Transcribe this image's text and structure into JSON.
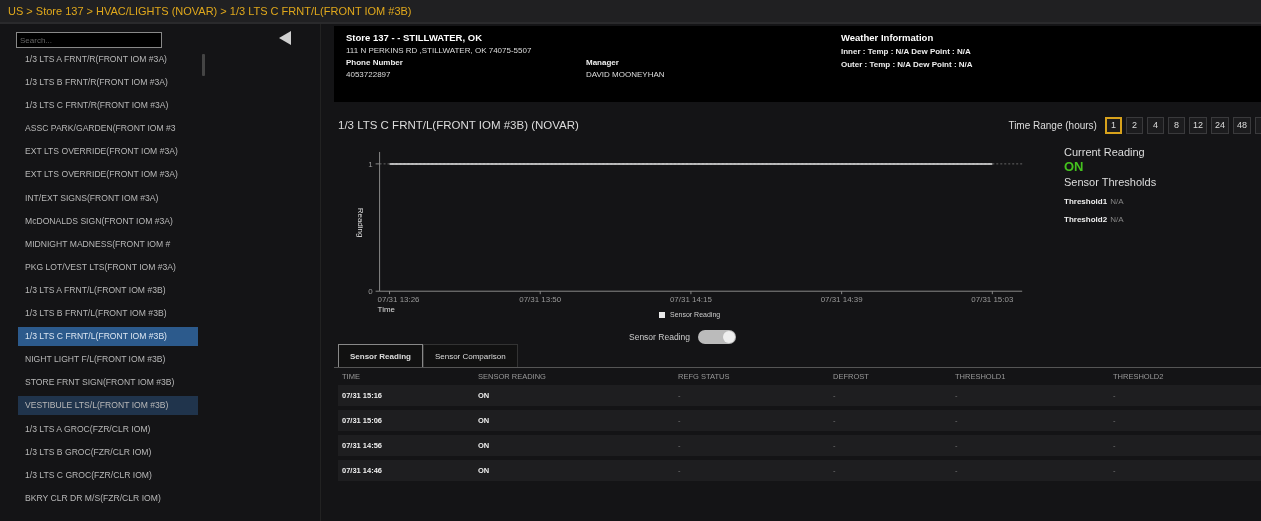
{
  "breadcrumb": "US > Store 137 > HVAC/LIGHTS (NOVAR) > 1/3 LTS C FRNT/L(FRONT IOM #3B)",
  "sidebar": {
    "search": {
      "placeholder": "Search..."
    },
    "items": [
      {
        "label": "1/3 LTS A FRNT/R(FRONT IOM #3A)",
        "selected": false,
        "highlighted": false
      },
      {
        "label": "1/3 LTS B FRNT/R(FRONT IOM #3A)",
        "selected": false,
        "highlighted": false
      },
      {
        "label": "1/3 LTS C FRNT/R(FRONT IOM #3A)",
        "selected": false,
        "highlighted": false
      },
      {
        "label": "ASSC PARK/GARDEN(FRONT IOM #3",
        "selected": false,
        "highlighted": false
      },
      {
        "label": "EXT LTS OVERRIDE(FRONT IOM #3A)",
        "selected": false,
        "highlighted": false
      },
      {
        "label": "EXT LTS OVERRIDE(FRONT IOM #3A)",
        "selected": false,
        "highlighted": false
      },
      {
        "label": "INT/EXT SIGNS(FRONT IOM #3A)",
        "selected": false,
        "highlighted": false
      },
      {
        "label": "McDONALDS SIGN(FRONT IOM #3A)",
        "selected": false,
        "highlighted": false
      },
      {
        "label": "MIDNIGHT MADNESS(FRONT IOM #",
        "selected": false,
        "highlighted": false
      },
      {
        "label": "PKG LOT/VEST LTS(FRONT IOM #3A)",
        "selected": false,
        "highlighted": false
      },
      {
        "label": "1/3 LTS A FRNT/L(FRONT IOM #3B)",
        "selected": false,
        "highlighted": false
      },
      {
        "label": "1/3 LTS B FRNT/L(FRONT IOM #3B)",
        "selected": false,
        "highlighted": false
      },
      {
        "label": "1/3 LTS C FRNT/L(FRONT IOM #3B)",
        "selected": true,
        "highlighted": false
      },
      {
        "label": "NIGHT LIGHT F/L(FRONT IOM #3B)",
        "selected": false,
        "highlighted": false
      },
      {
        "label": "STORE FRNT SIGN(FRONT IOM #3B)",
        "selected": false,
        "highlighted": false
      },
      {
        "label": "VESTIBULE LTS/L(FRONT IOM #3B)",
        "selected": false,
        "highlighted": true
      },
      {
        "label": "1/3 LTS A GROC(FZR/CLR IOM)",
        "selected": false,
        "highlighted": false
      },
      {
        "label": "1/3 LTS B GROC(FZR/CLR IOM)",
        "selected": false,
        "highlighted": false
      },
      {
        "label": "1/3 LTS C GROC(FZR/CLR IOM)",
        "selected": false,
        "highlighted": false
      },
      {
        "label": "BKRY CLR DR M/S(FZR/CLR IOM)",
        "selected": false,
        "highlighted": false
      }
    ]
  },
  "store": {
    "title": "Store 137 - - STILLWATER, OK",
    "address": "111 N PERKINS RD ,STILLWATER, OK 74075-5507",
    "phone_label": "Phone Number",
    "phone": "4053722897",
    "manager_label": "Manager",
    "manager": "DAVID MOONEYHAN"
  },
  "weather": {
    "title": "Weather Information",
    "inner": "Inner : Temp : N/A Dew Point : N/A",
    "outer": "Outer : Temp : N/A Dew Point : N/A"
  },
  "sensor_title": "1/3 LTS C FRNT/L(FRONT IOM #3B) (NOVAR)",
  "time_range": {
    "label": "Time Range (hours)",
    "options": [
      {
        "label": "1",
        "selected": true
      },
      {
        "label": "2",
        "selected": false
      },
      {
        "label": "4",
        "selected": false
      },
      {
        "label": "8",
        "selected": false
      },
      {
        "label": "12",
        "selected": false
      },
      {
        "label": "24",
        "selected": false
      },
      {
        "label": "48",
        "selected": false
      }
    ]
  },
  "chart": {
    "chart_data": {
      "type": "line",
      "xlabel": "Time",
      "ylabel": "Reading",
      "x": [
        "07/31 13:26",
        "07/31 13:50",
        "07/31 14:15",
        "07/31 14:39",
        "07/31 15:03"
      ],
      "series": [
        {
          "name": "Sensor Reading",
          "color": "#e8e8e8",
          "values": [
            1,
            1,
            1,
            1,
            1
          ]
        }
      ],
      "ylim": [
        0,
        1
      ],
      "yticks": [
        0,
        1
      ]
    }
  },
  "current": {
    "title": "Current Reading",
    "value": "ON",
    "thresholds_title": "Sensor Thresholds",
    "thresholds": [
      {
        "label": "Threshold1",
        "value": "N/A"
      },
      {
        "label": "Threshold2",
        "value": "N/A"
      }
    ]
  },
  "toggle": {
    "label": "Sensor Reading",
    "on": true
  },
  "tabs": [
    {
      "label": "Sensor Reading",
      "selected": true
    },
    {
      "label": "Sensor Comparison",
      "selected": false
    }
  ],
  "table": {
    "columns": [
      "TIME",
      "SENSOR READING",
      "REFG STATUS",
      "DEFROST",
      "THRESHOLD1",
      "THRESHOLD2"
    ],
    "rows": [
      [
        "07/31 15:16",
        "ON",
        "-",
        "-",
        "-",
        "-"
      ],
      [
        "07/31 15:06",
        "ON",
        "-",
        "-",
        "-",
        "-"
      ],
      [
        "07/31 14:56",
        "ON",
        "-",
        "-",
        "-",
        "-"
      ],
      [
        "07/31 14:46",
        "ON",
        "-",
        "-",
        "-",
        "-"
      ]
    ]
  }
}
